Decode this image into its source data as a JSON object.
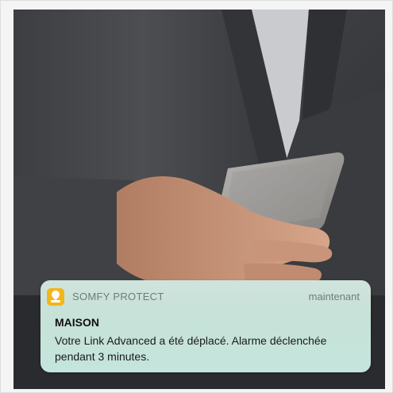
{
  "notification": {
    "app_name": "SOMFY PROTECT",
    "timestamp": "maintenant",
    "title": "MAISON",
    "body": "Votre Link Advanced a été déplacé. Alarme déclenchée pendant 3 minutes.",
    "app_icon": "home-pin-icon",
    "accent_color": "#f2b619",
    "background_color": "#c7e2d8"
  },
  "photo": {
    "subject": "person-holding-smartphone"
  }
}
